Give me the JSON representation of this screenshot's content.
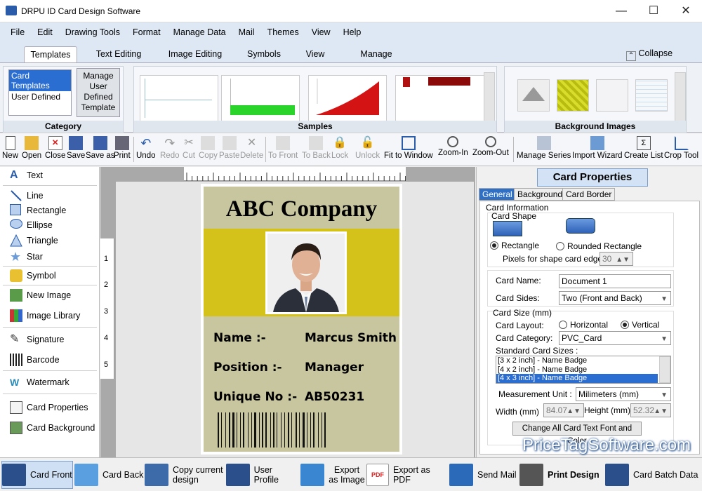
{
  "window": {
    "title": "DRPU ID Card Design Software"
  },
  "menu": [
    "File",
    "Edit",
    "Drawing Tools",
    "Format",
    "Manage Data",
    "Mail",
    "Themes",
    "View",
    "Help"
  ],
  "ribbon_tabs": [
    "Templates",
    "Text Editing",
    "Image Editing",
    "Symbols",
    "View",
    "Manage Data"
  ],
  "collapse_label": "Collapse",
  "category": {
    "label": "Category",
    "items": [
      "Card Templates",
      "User Defined"
    ],
    "manage_btn": "Manage User Defined Template"
  },
  "samples_label": "Samples",
  "bg_images_label": "Background Images",
  "toolbar": [
    "New",
    "Open",
    "Close",
    "Save",
    "Save as",
    "Print",
    "Undo",
    "Redo",
    "Cut",
    "Copy",
    "Paste",
    "Delete",
    "To Front",
    "To Back",
    "Lock",
    "Unlock",
    "Fit to Window",
    "Zoom-In",
    "Zoom-Out",
    "Manage Series",
    "Import Wizard",
    "Create List",
    "Crop Tool"
  ],
  "left_tools": [
    "Text",
    "Line",
    "Rectangle",
    "Ellipse",
    "Triangle",
    "Star",
    "Symbol",
    "New Image",
    "Image Library",
    "Signature",
    "Barcode",
    "Watermark",
    "Card Properties",
    "Card Background"
  ],
  "ruler_left_numbers": [
    "1",
    "2",
    "3",
    "4",
    "5"
  ],
  "card": {
    "company": "ABC Company",
    "name_label": "Name :-",
    "name_value": "Marcus Smith",
    "position_label": "Position :-",
    "position_value": "Manager",
    "unique_label": "Unique No :-",
    "unique_value": "AB50231",
    "band_color": "#d4c21a",
    "bg_color": "#c8c69e"
  },
  "props": {
    "title": "Card Properties",
    "tabs": [
      "General",
      "Background",
      "Card Border"
    ],
    "card_information": "Card Information",
    "card_shape": "Card Shape",
    "shape_rect": "Rectangle",
    "shape_round": "Rounded Rectangle",
    "pixels_label": "Pixels for shape card edge :",
    "pixels_value": "30",
    "card_name_label": "Card Name:",
    "card_name_value": "Document 1",
    "card_sides_label": "Card Sides:",
    "card_sides_value": "Two (Front and Back)",
    "card_size": "Card Size (mm)",
    "layout_label": "Card Layout:",
    "layout_h": "Horizontal",
    "layout_v": "Vertical",
    "category_label": "Card Category:",
    "category_value": "PVC_Card",
    "std_sizes_label": "Standard Card Sizes :",
    "std_sizes": [
      "[3 x 2 inch] - Name Badge",
      "[4 x 2 inch] - Name Badge",
      "[4 x 3 inch] - Name Badge"
    ],
    "unit_label": "Measurement Unit :",
    "unit_value": "Milimeters (mm)",
    "width_label": "Width  (mm)",
    "width_value": "84.07",
    "height_label": "Height  (mm)",
    "height_value": "52.32",
    "change_btn": "Change All Card Text Font and Color"
  },
  "watermark": "PriceTagSoftware.com",
  "bottom": [
    "Card Front",
    "Card Back",
    "Copy current design",
    "User Profile",
    "Export as Image",
    "Export as PDF",
    "Send Mail",
    "Print Design",
    "Card Batch Data"
  ]
}
